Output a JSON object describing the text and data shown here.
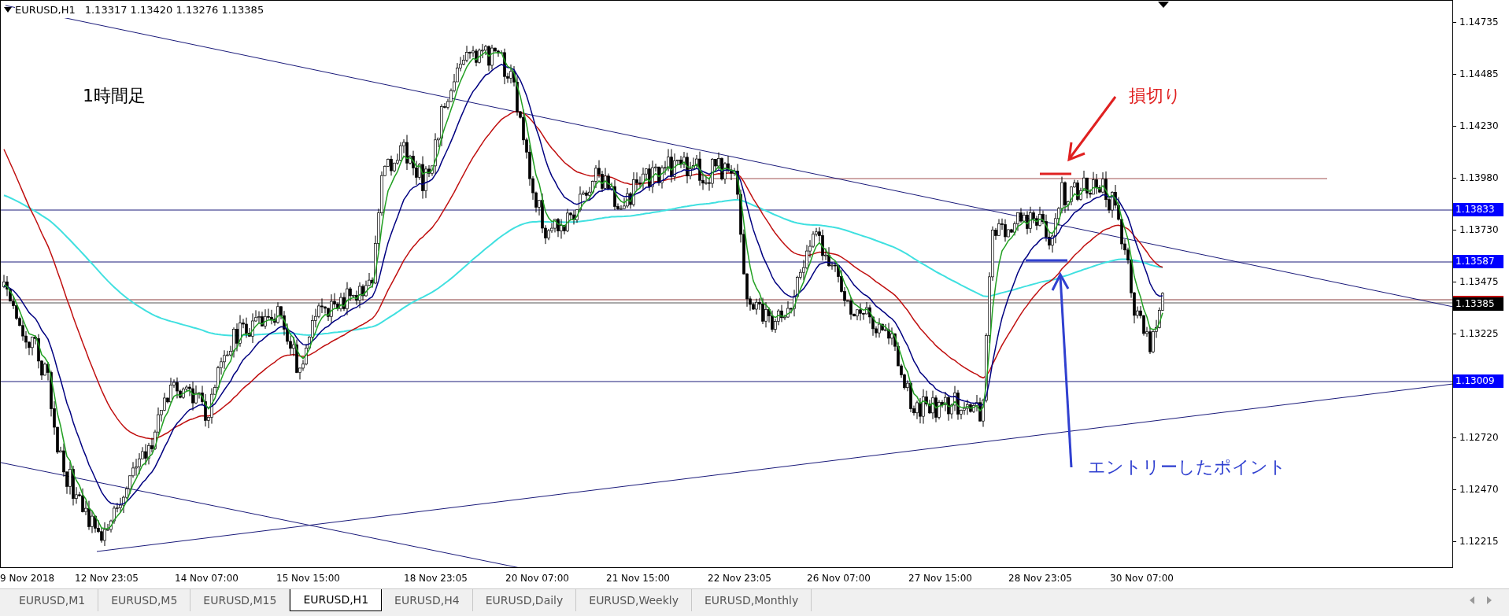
{
  "header": {
    "symbol": "EURUSD,H1",
    "ohlc": [
      "1.13317",
      "1.13420",
      "1.13276",
      "1.13385"
    ]
  },
  "annotations": [
    {
      "kind": "label",
      "text": "1時間足"
    },
    {
      "kind": "stop",
      "text": "損切り"
    },
    {
      "kind": "entry",
      "text": "エントリーしたポイント"
    }
  ],
  "price_axis": {
    "ticks": [
      "1.14735",
      "1.14485",
      "1.14230",
      "1.13980",
      "1.13730",
      "1.13475",
      "1.13225",
      "1.12720",
      "1.12470",
      "1.12215"
    ],
    "levels": [
      {
        "kind": "line",
        "text": "1.13833"
      },
      {
        "kind": "line",
        "text": "1.13587"
      },
      {
        "kind": "current",
        "text": "1.13385"
      },
      {
        "kind": "line",
        "text": "1.13009"
      }
    ]
  },
  "time_axis": [
    "9 Nov 2018",
    "12 Nov 23:05",
    "14 Nov 07:00",
    "15 Nov 15:00",
    "18 Nov 23:05",
    "20 Nov 07:00",
    "21 Nov 15:00",
    "22 Nov 23:05",
    "26 Nov 07:00",
    "27 Nov 15:00",
    "28 Nov 23:05",
    "30 Nov 07:00"
  ],
  "tabs": [
    {
      "label": "EURUSD,M1",
      "selected": false
    },
    {
      "label": "EURUSD,M5",
      "selected": false
    },
    {
      "label": "EURUSD,M15",
      "selected": false
    },
    {
      "label": "EURUSD,H1",
      "selected": true
    },
    {
      "label": "EURUSD,H4",
      "selected": false
    },
    {
      "label": "EURUSD,Daily",
      "selected": false
    },
    {
      "label": "EURUSD,Weekly",
      "selected": false
    },
    {
      "label": "EURUSD,Monthly",
      "selected": false
    }
  ]
}
